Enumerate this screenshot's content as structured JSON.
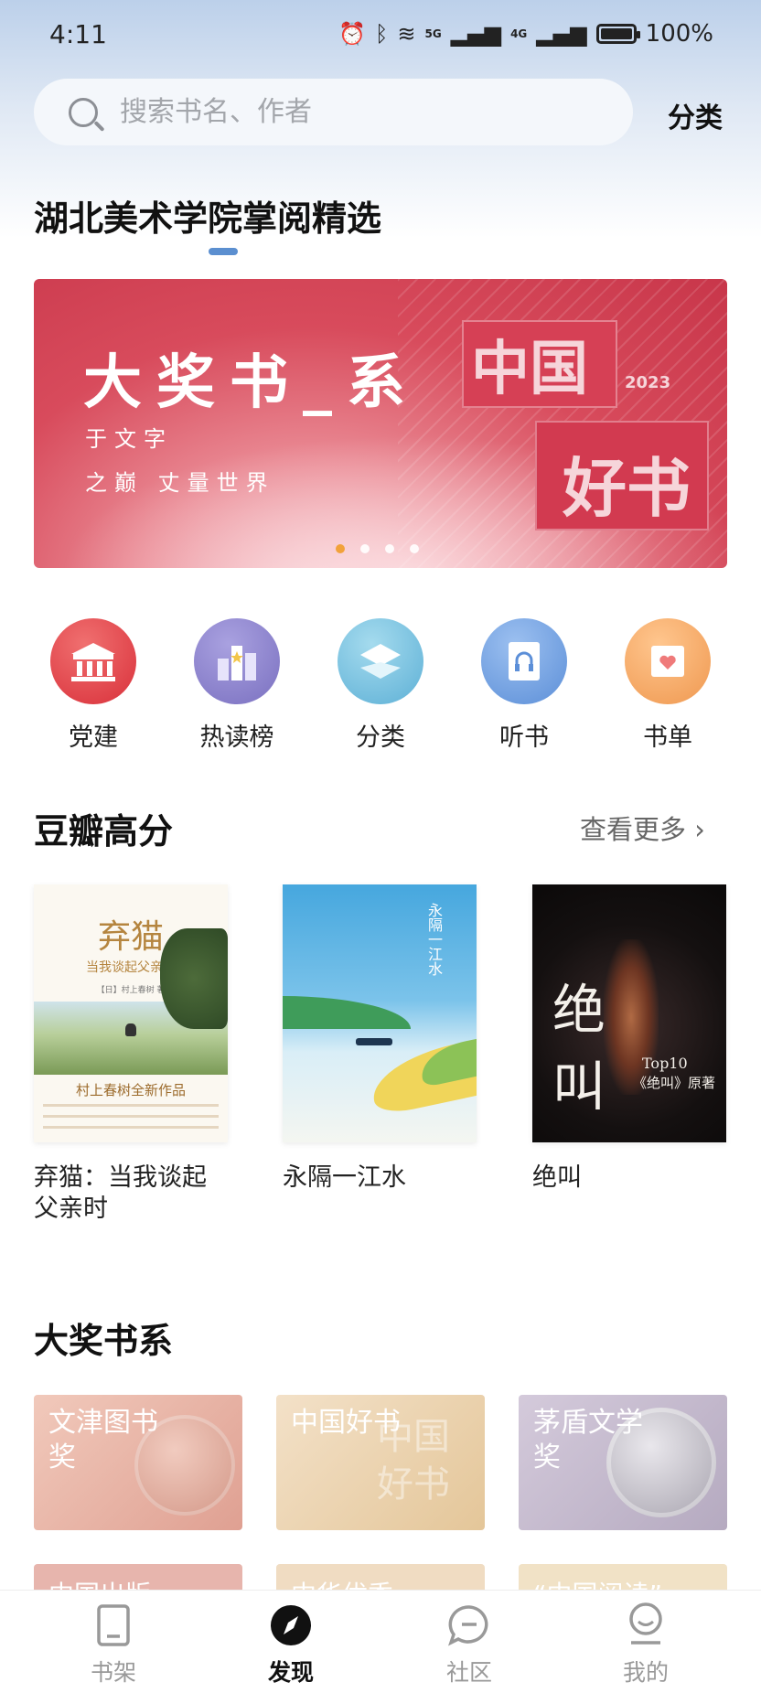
{
  "status_bar": {
    "time": "4:11",
    "network1": "5G",
    "network2": "4G",
    "battery": "100%"
  },
  "search": {
    "placeholder": "搜索书名、作者",
    "category_label": "分类"
  },
  "featured": {
    "title": "湖北美术学院掌阅精选"
  },
  "banner": {
    "title": "大奖书_系",
    "line1": "于文字",
    "line2": "之巅  丈量世界",
    "logo_top": "中国",
    "logo_year": "2023",
    "logo_bottom": "好书",
    "slide_count": 4,
    "active_slide": 1
  },
  "quick_nav": [
    {
      "label": "党建",
      "icon": "party-building-icon",
      "color": "#e0434b"
    },
    {
      "label": "热读榜",
      "icon": "ranking-icon",
      "color": "#8f86cf"
    },
    {
      "label": "分类",
      "icon": "category-icon",
      "color": "#6cb6d8"
    },
    {
      "label": "听书",
      "icon": "audiobook-icon",
      "color": "#6f9ee0"
    },
    {
      "label": "书单",
      "icon": "booklist-icon",
      "color": "#f0a060"
    }
  ],
  "douban": {
    "title": "豆瓣高分",
    "more": "查看更多 ›",
    "books": [
      {
        "title": "弃猫：当我谈起父亲时",
        "cover_title": "弃猫",
        "cover_subtitle": "当我谈起父亲时",
        "cover_author": "【日】村上春树 著",
        "cover_tagline": "村上春树全新作品"
      },
      {
        "title": "永隔一江水",
        "cover_title": "永隔一江水"
      },
      {
        "title": "绝叫",
        "cover_title": "绝叫",
        "cover_tagline": "Top10",
        "cover_subtitle": "《绝叫》原著"
      }
    ]
  },
  "awards": {
    "title": "大奖书系",
    "cards": [
      {
        "label": "文津图书奖",
        "colors": [
          "#efc2b2",
          "#e0a395"
        ]
      },
      {
        "label": "中国好书",
        "watermark": "中国好书",
        "colors": [
          "#f1dcc0",
          "#e3c296"
        ]
      },
      {
        "label": "茅盾文学奖",
        "colors": [
          "#cfc4d6",
          "#b3a7bd"
        ]
      }
    ],
    "next_cards": [
      {
        "label": "中国出版"
      },
      {
        "label": "中华优秀"
      },
      {
        "label": "“中国阅读”"
      }
    ]
  },
  "bottom_nav": [
    {
      "label": "书架",
      "icon": "bookshelf-icon",
      "active": false
    },
    {
      "label": "发现",
      "icon": "discover-compass-icon",
      "active": true
    },
    {
      "label": "社区",
      "icon": "community-chat-icon",
      "active": false
    },
    {
      "label": "我的",
      "icon": "profile-icon",
      "active": false
    }
  ]
}
